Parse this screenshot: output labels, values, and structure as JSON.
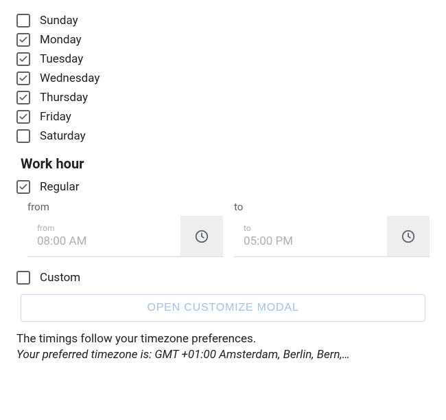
{
  "days": [
    {
      "label": "Sunday",
      "checked": false
    },
    {
      "label": "Monday",
      "checked": true
    },
    {
      "label": "Tuesday",
      "checked": true
    },
    {
      "label": "Wednesday",
      "checked": true
    },
    {
      "label": "Thursday",
      "checked": true
    },
    {
      "label": "Friday",
      "checked": true
    },
    {
      "label": "Saturday",
      "checked": false
    }
  ],
  "work_hour_heading": "Work hour",
  "regular": {
    "label": "Regular",
    "checked": true
  },
  "from": {
    "label": "from",
    "inner_label": "from",
    "value": "08:00 AM"
  },
  "to": {
    "label": "to",
    "inner_label": "to",
    "value": "05:00 PM"
  },
  "custom": {
    "label": "Custom",
    "checked": false
  },
  "modal_button": "OPEN CUSTOMIZE MODAL",
  "footer_line1": "The timings follow your timezone preferences.",
  "footer_line2": "Your preferred timezone is: GMT +01:00 Amsterdam, Berlin, Bern,…"
}
